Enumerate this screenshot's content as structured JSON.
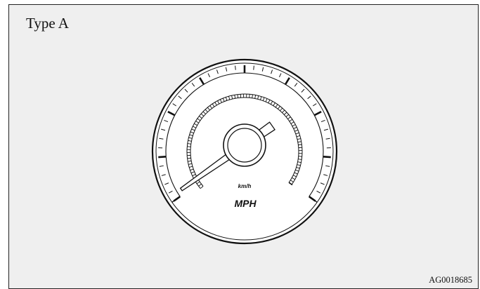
{
  "title": "Type A",
  "figure_code": "AG0018685",
  "gauge": {
    "unit_primary": "MPH",
    "unit_secondary": "km/h",
    "needle_position": 0.0,
    "colors": {
      "background": "#efefef",
      "face": "#ffffff",
      "ink": "#111111"
    }
  }
}
